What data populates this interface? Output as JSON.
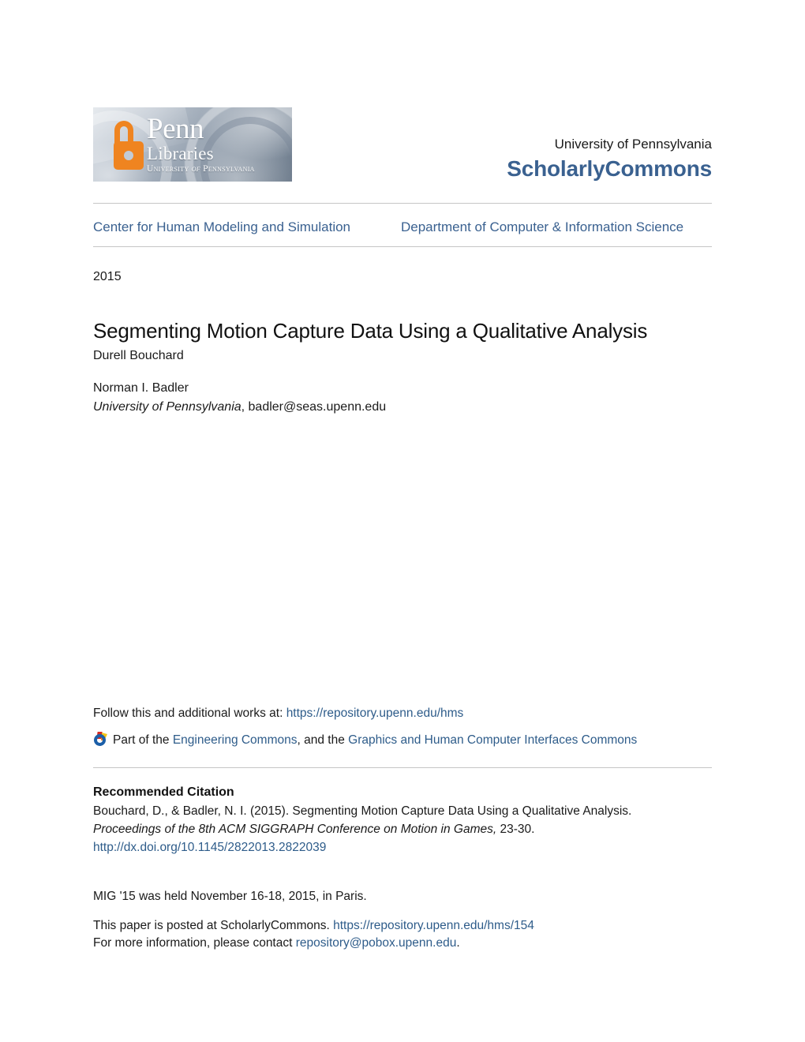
{
  "header": {
    "logo": {
      "alt": "Penn Libraries, University of Pennsylvania",
      "wordmark_penn": "Penn",
      "wordmark_libraries": "Libraries",
      "wordmark_university": "University",
      "wordmark_of": "of",
      "wordmark_state": "Pennsylvania",
      "accent_color": "#ef8420"
    },
    "university": "University of Pennsylvania",
    "repository": "ScholarlyCommons",
    "repository_color": "#3a6190"
  },
  "nav": {
    "left_label": "Center for Human Modeling and Simulation",
    "right_label": "Department of Computer & Information Science"
  },
  "record": {
    "year": "2015",
    "title": "Segmenting Motion Capture Data Using a Qualitative Analysis",
    "authors": [
      {
        "name": "Durell Bouchard",
        "institution": "",
        "email": ""
      },
      {
        "name": "Norman I. Badler",
        "institution": "University of Pennsylvania",
        "email": "badler@seas.upenn.edu"
      }
    ]
  },
  "follow": {
    "prefix": "Follow this and additional works at: ",
    "url": "https://repository.upenn.edu/hms"
  },
  "subjects": {
    "icon": "digital-commons-network-icon",
    "prefix": "Part of the ",
    "link1": "Engineering Commons",
    "middle": ", and the ",
    "link2": "Graphics and Human Computer Interfaces Commons"
  },
  "citation": {
    "heading": "Recommended Citation",
    "line1": "Bouchard, D., & Badler, N. I. (2015). Segmenting Motion Capture Data Using a Qualitative Analysis. ",
    "journal": "Proceedings of the 8th ACM SIGGRAPH Conference on Motion in Games,",
    "pages": " 23-30. ",
    "doi": "http://dx.doi.org/10.1145/2822013.2822039"
  },
  "notes": {
    "conference": "MIG '15 was held November 16-18, 2015, in Paris.",
    "posted_prefix": "This paper is posted at ScholarlyCommons. ",
    "posted_url": "https://repository.upenn.edu/hms/154",
    "contact_prefix": "For more information, please contact ",
    "contact_email": "repository@pobox.upenn.edu",
    "contact_suffix": "."
  },
  "colors": {
    "link": "#2e5c8a",
    "heading_blue": "#3a6190",
    "rule": "#c6c6c6"
  }
}
